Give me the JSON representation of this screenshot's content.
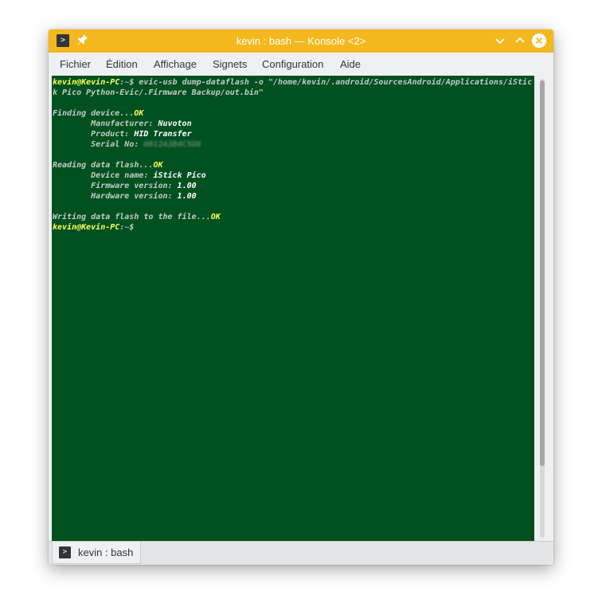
{
  "window": {
    "title": "kevin : bash — Konsole <2>"
  },
  "menu": [
    "Fichier",
    "Édition",
    "Affichage",
    "Signets",
    "Configuration",
    "Aide"
  ],
  "terminal": {
    "prompt_user": "kevin@Kevin-PC",
    "prompt_sep": ":",
    "prompt_path": "~",
    "prompt_symbol": "$",
    "command_line1": " evic-usb dump-dataflash -o \"/home/kevin/.android/SourcesAndroid/Applications/iStic",
    "command_line2": "k Pico Python-Evic/.Firmware Backup/out.bin\"",
    "finding_label": "Finding device...",
    "ok": "OK",
    "manufacturer_label": "        Manufacturer: ",
    "manufacturer_value": "Nuvoton",
    "product_label": "        Product: ",
    "product_value": "HID Transfer",
    "serial_label": "        Serial No: ",
    "serial_value": "0012A3B4C5D6",
    "reading_label": "Reading data flash...",
    "device_name_label": "        Device name: ",
    "device_name_value": "iStick Pico",
    "firmware_label": "        Firmware version: ",
    "firmware_value": "1.00",
    "hardware_label": "        Hardware version: ",
    "hardware_value": "1.00",
    "writing_label": "Writing data flash to the file...",
    "colors": {
      "background": "#005020",
      "prompt": "#ffff54",
      "path": "#8fb8d8"
    }
  },
  "tabs": [
    {
      "label": "kevin : bash",
      "icon": "terminal-icon"
    }
  ]
}
